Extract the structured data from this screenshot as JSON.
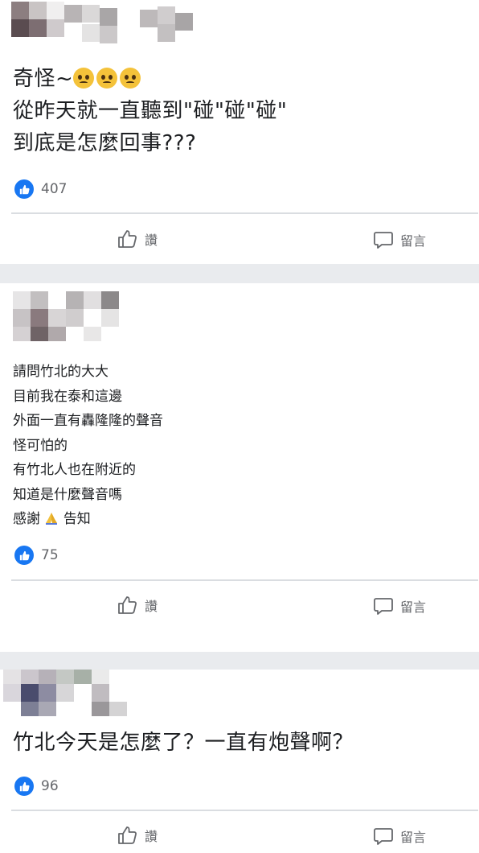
{
  "posts": [
    {
      "lines": [
        "奇怪~",
        "從昨天就一直聽到\"碰\"碰\"碰\"",
        "到底是怎麼回事???"
      ],
      "emoji": [
        "disappointed-face",
        "disappointed-face",
        "disappointed-face"
      ],
      "likes": "407"
    },
    {
      "lines": [
        "請問竹北的大大",
        "目前我在泰和這邊",
        "外面一直有轟隆隆的聲音",
        "怪可怕的",
        "有竹北人也在附近的",
        "知道是什麼聲音嗎",
        "感謝",
        "告知"
      ],
      "emoji": [
        "folded-hands"
      ],
      "likes": "75"
    },
    {
      "lines": [
        "竹北今天是怎麼了？一直有炮聲啊？"
      ],
      "likes": "96"
    }
  ],
  "actions": {
    "like": "讚",
    "comment": "留言"
  },
  "colors": {
    "like_blue": "#1877f2",
    "emoji_yellow": "#f4c23a",
    "muted_text": "#65676b",
    "page_bg": "#e9ebee"
  },
  "icons": [
    "thumbs-up-icon",
    "comment-icon",
    "like-badge-icon"
  ]
}
